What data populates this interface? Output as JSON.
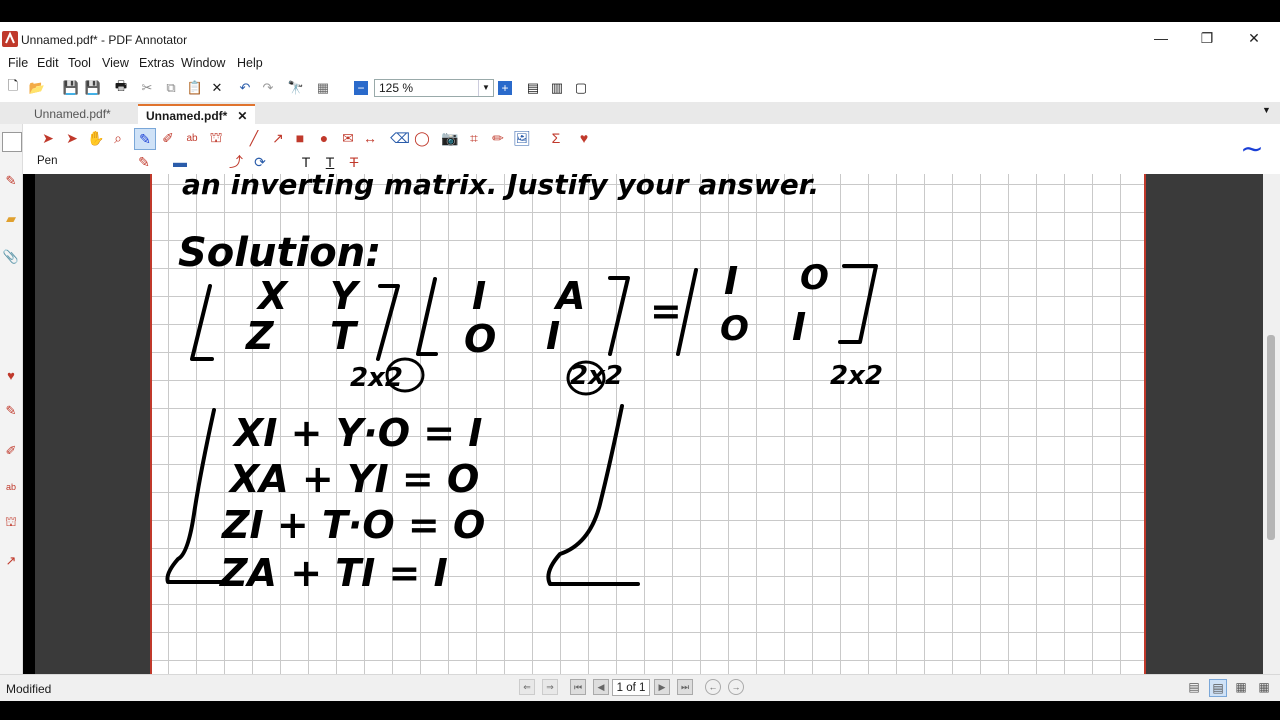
{
  "window": {
    "title": "Unnamed.pdf* - PDF Annotator",
    "minimize": "—",
    "restore": "❐",
    "close": "✕"
  },
  "menu": [
    "File",
    "Edit",
    "Tool",
    "View",
    "Extras",
    "Window",
    "Help"
  ],
  "toolbar": {
    "zoom": "125 %"
  },
  "tabs": [
    {
      "label": "Unnamed.pdf*"
    },
    {
      "label": "Unnamed.pdf*",
      "close": "✕"
    }
  ],
  "ribbon": {
    "tool_label": "Pen"
  },
  "status": {
    "text": "Modified",
    "page": "1 of 1"
  },
  "colors": {
    "accent": "#e0732e",
    "border": "#c0392b",
    "pen": "#1a3fd6"
  },
  "handwriting": {
    "line1": "an inverting matrix. Justify your answer.",
    "solution": "Solution:",
    "matrixX": [
      "X",
      "Y",
      "Z",
      "T"
    ],
    "matrixA": [
      "I",
      "A",
      "O",
      "I"
    ],
    "matrixI": [
      "I",
      "O",
      "O",
      "I"
    ],
    "dim1": "2x2",
    "dim2": "2x2",
    "dim3": "2x2",
    "eq1": "XI + Y·O = I",
    "eq2": "XA + YI = O",
    "eq3": "ZI + T·O = O",
    "eq4": "ZA + TI = I"
  }
}
